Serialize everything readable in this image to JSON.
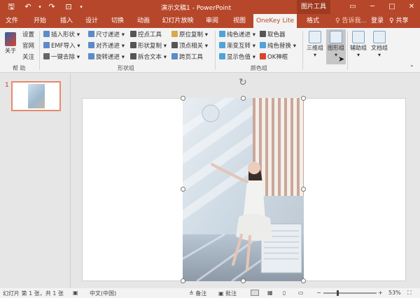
{
  "titlebar": {
    "title": "演示文稿1 - PowerPoint",
    "context_label": "图片工具",
    "qat": [
      "save-icon",
      "undo-icon",
      "redo-icon",
      "present-icon",
      "customize-icon"
    ],
    "win": [
      "─",
      "□",
      "✕"
    ]
  },
  "tabs": [
    {
      "label": "文件"
    },
    {
      "label": "开始"
    },
    {
      "label": "插入"
    },
    {
      "label": "设计"
    },
    {
      "label": "切换"
    },
    {
      "label": "动画"
    },
    {
      "label": "幻灯片放映"
    },
    {
      "label": "审阅"
    },
    {
      "label": "视图"
    },
    {
      "label": "OneKey Lite"
    },
    {
      "label": "格式"
    }
  ],
  "tellme": "♀ 告诉我...",
  "login": "登录",
  "share": "♀ 共享",
  "ribbon": {
    "help": {
      "about": "关于",
      "settings": "设置",
      "official": "官网",
      "follow": "关注",
      "group": "帮 助"
    },
    "shape": {
      "c1": [
        "插入形状 ▾",
        "EMF导入 ▾",
        "一键去除 ▾"
      ],
      "c2": [
        "尺寸递进 ▾",
        "对齐递进 ▾",
        "旋转递进 ▾"
      ],
      "c3": [
        "控点工具",
        "形状复制 ▾",
        "拆合文本 ▾"
      ],
      "c4": [
        "原位复制 ▾",
        "顶点相关 ▾",
        "跨页工具"
      ],
      "group": "形状组"
    },
    "color": {
      "c1": [
        "纯色递进 ▾",
        "渐变互转 ▾",
        "显示色值 ▾"
      ],
      "c2": [
        "取色器",
        "纯色替换 ▾",
        "OK神框"
      ],
      "group": "颜色组"
    },
    "big": [
      {
        "label": "三维组 ▾"
      },
      {
        "label": "图形组 ▾"
      },
      {
        "label": "辅助组 ▾"
      },
      {
        "label": "文档组 ▾"
      }
    ]
  },
  "thumbnails": {
    "number": "1"
  },
  "statusbar": {
    "slide_info": "幻灯片 第 1 张，共 1 张",
    "language": "中文(中国)",
    "notes": "≜ 备注",
    "comments": "▣ 批注",
    "zoom": "53%",
    "zoom_fraction": 0.53
  },
  "colors": {
    "accent": "#b7472a",
    "ribbon_bg": "#f3f3f3"
  }
}
